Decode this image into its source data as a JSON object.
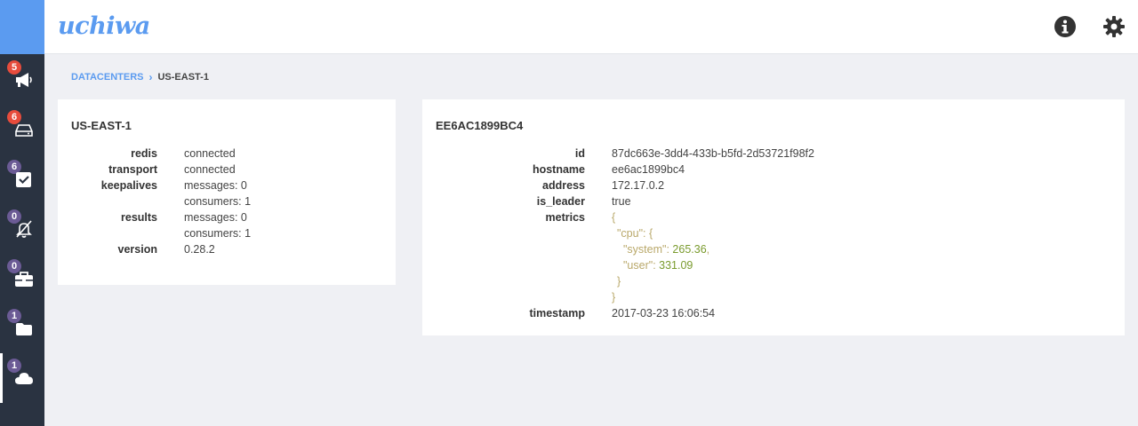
{
  "app": {
    "brand": "uchiwa"
  },
  "sidebar": {
    "items": [
      {
        "name": "events",
        "icon": "megaphone-icon",
        "badge": "5",
        "badge_color": "#e74c3c"
      },
      {
        "name": "clients",
        "icon": "hard-drive-icon",
        "badge": "6",
        "badge_color": "#e74c3c"
      },
      {
        "name": "checks",
        "icon": "checkbox-icon",
        "badge": "6",
        "badge_color": "#6b5b95"
      },
      {
        "name": "silenced",
        "icon": "bell-slash-icon",
        "badge": "0",
        "badge_color": "#6b5b95"
      },
      {
        "name": "stashes",
        "icon": "briefcase-icon",
        "badge": "0",
        "badge_color": "#6b5b95"
      },
      {
        "name": "aggregates",
        "icon": "folder-icon",
        "badge": "1",
        "badge_color": "#6b5b95"
      },
      {
        "name": "datacenters",
        "icon": "cloud-icon",
        "badge": "1",
        "badge_color": "#6b5b95",
        "active": true
      }
    ]
  },
  "topbar": {
    "info_icon": "info-icon",
    "settings_icon": "gear-icon"
  },
  "breadcrumb": {
    "root": "DATACENTERS",
    "separator": "›",
    "current": "US-EAST-1"
  },
  "datacenter": {
    "title": "US-EAST-1",
    "rows": [
      {
        "key": "redis",
        "value": "connected"
      },
      {
        "key": "transport",
        "value": "connected"
      },
      {
        "key": "keepalives",
        "value": "messages: 0"
      },
      {
        "key": "",
        "value": "consumers: 1"
      },
      {
        "key": "results",
        "value": "messages: 0"
      },
      {
        "key": "",
        "value": "consumers: 1"
      },
      {
        "key": "version",
        "value": "0.28.2"
      }
    ]
  },
  "server": {
    "title": "EE6AC1899BC4",
    "id_label": "id",
    "id": "87dc663e-3dd4-433b-b5fd-2d53721f98f2",
    "hostname_label": "hostname",
    "hostname": "ee6ac1899bc4",
    "address_label": "address",
    "address": "172.17.0.2",
    "is_leader_label": "is_leader",
    "is_leader": "true",
    "metrics_label": "metrics",
    "metrics": {
      "open": "{",
      "cpu_key": "\"cpu\"",
      "cpu_open": ": {",
      "system_key": "\"system\"",
      "system_value": "265.36",
      "user_key": "\"user\"",
      "user_value": "331.09",
      "cpu_close": "}",
      "close": "}"
    },
    "timestamp_label": "timestamp",
    "timestamp": "2017-03-23 16:06:54"
  }
}
